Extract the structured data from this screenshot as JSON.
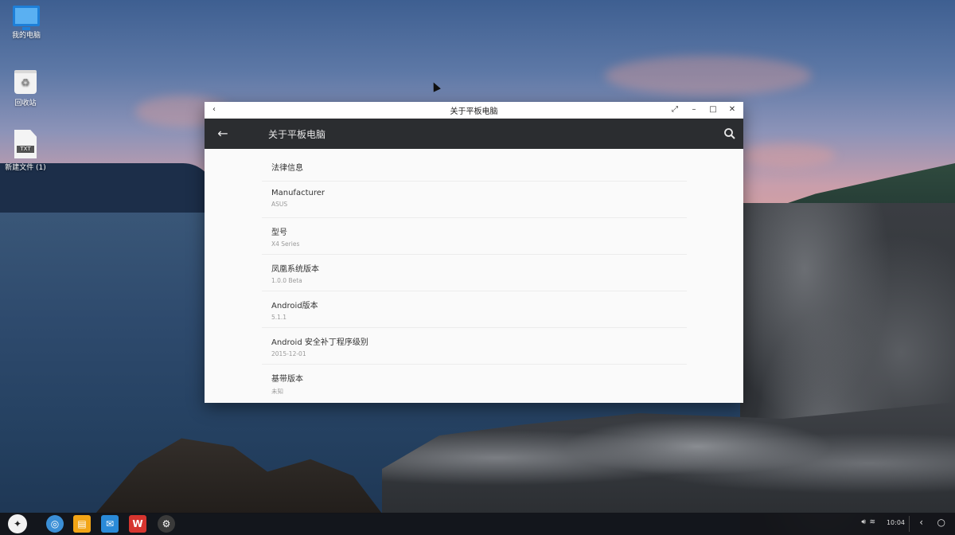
{
  "desktop": {
    "icons": [
      {
        "label": "我的电脑",
        "icon": "monitor-icon"
      },
      {
        "label": "回收站",
        "icon": "trash-icon"
      },
      {
        "label": "新建文件 (1)",
        "icon": "text-file-icon"
      }
    ]
  },
  "window": {
    "title": "关于平板电脑",
    "controls": {
      "back": "‹",
      "fullscreen": "⤢",
      "minimize": "–",
      "maximize": "□",
      "close": "✕"
    }
  },
  "appbar": {
    "back_icon": "←",
    "title": "关于平板电脑",
    "search_icon": "search-icon"
  },
  "settings": [
    {
      "label": "法律信息",
      "value": ""
    },
    {
      "label": "Manufacturer",
      "value": "ASUS"
    },
    {
      "label": "型号",
      "value": "X4 Series"
    },
    {
      "label": "凤凰系统版本",
      "value": "1.0.0 Beta"
    },
    {
      "label": "Android版本",
      "value": "5.1.1"
    },
    {
      "label": "Android 安全补丁程序级别",
      "value": "2015-12-01"
    },
    {
      "label": "基带版本",
      "value": "未知"
    }
  ],
  "taskbar": {
    "start_icon": "phoenix-logo-icon",
    "apps": [
      {
        "name": "browser",
        "icon": "globe-icon",
        "color": "#3b8fd6"
      },
      {
        "name": "file-manager",
        "icon": "folder-icon",
        "color": "#f2a516"
      },
      {
        "name": "mail",
        "icon": "mail-icon",
        "color": "#2a8ad8"
      },
      {
        "name": "wps",
        "icon": "wps-icon",
        "color": "#d6352f"
      },
      {
        "name": "settings",
        "icon": "gear-icon",
        "color": "#3a3a3a"
      }
    ],
    "clock": "10:04",
    "tray_back": "‹",
    "tray_home": "○"
  }
}
